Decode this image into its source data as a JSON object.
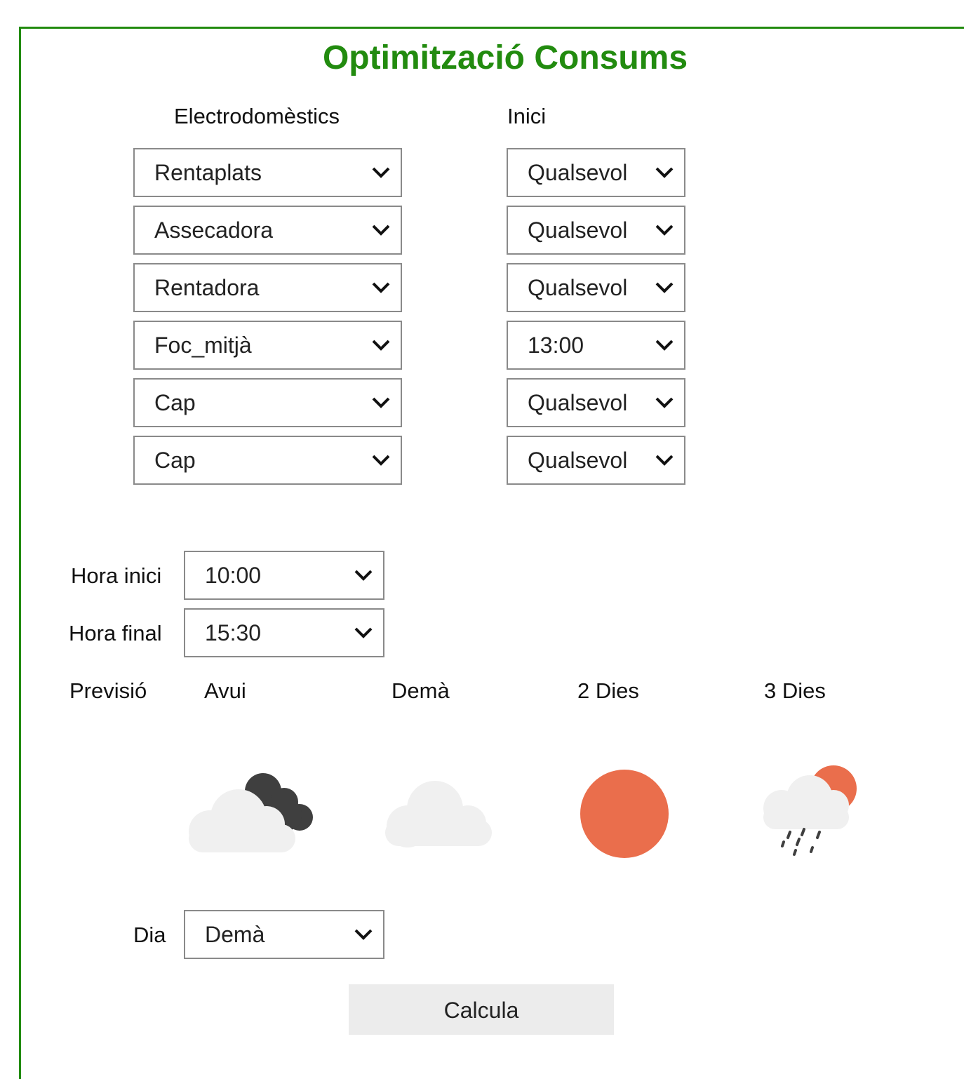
{
  "title": "Optimització Consums",
  "headers": {
    "appliances": "Electrodomèstics",
    "start": "Inici"
  },
  "appliances": [
    {
      "appliance": "Rentaplats",
      "start": "Qualsevol"
    },
    {
      "appliance": "Assecadora",
      "start": "Qualsevol"
    },
    {
      "appliance": "Rentadora",
      "start": "Qualsevol"
    },
    {
      "appliance": "Foc_mitjà",
      "start": "13:00"
    },
    {
      "appliance": "Cap",
      "start": "Qualsevol"
    },
    {
      "appliance": "Cap",
      "start": "Qualsevol"
    }
  ],
  "hours": {
    "start_label": "Hora inici",
    "start_value": "10:00",
    "end_label": "Hora final",
    "end_value": "15:30"
  },
  "forecast": {
    "label": "Previsió",
    "days": [
      {
        "name": "Avui",
        "icon": "cloudy-dark-cloud-icon"
      },
      {
        "name": "Demà",
        "icon": "cloud-icon"
      },
      {
        "name": "2 Dies",
        "icon": "sun-icon"
      },
      {
        "name": "3 Dies",
        "icon": "rain-sun-cloud-icon"
      }
    ]
  },
  "day": {
    "label": "Dia",
    "value": "Demà"
  },
  "calculate_label": "Calcula",
  "colors": {
    "accent": "#228b0f",
    "sun": "#ea6e4c",
    "cloud": "#f0f0f0",
    "dark_cloud": "#3f3f3f"
  }
}
